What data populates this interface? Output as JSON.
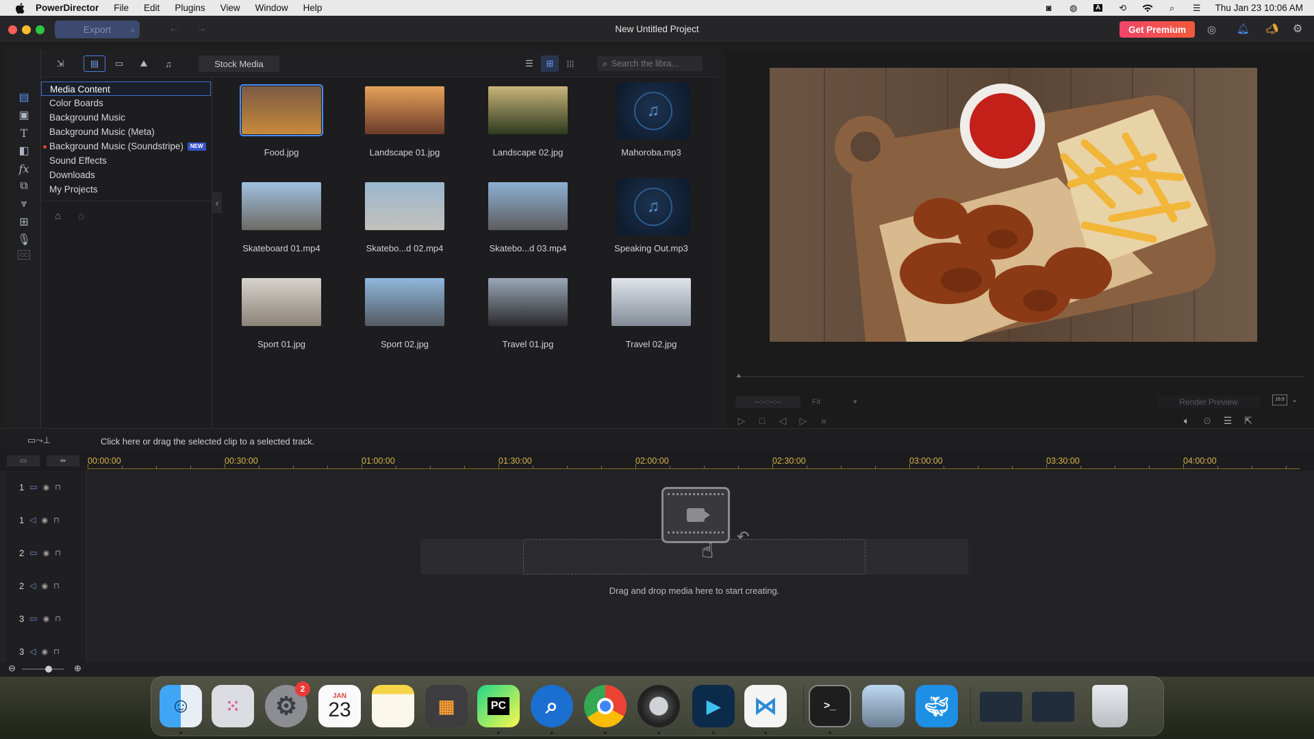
{
  "menubar": {
    "app_name": "PowerDirector",
    "items": [
      "File",
      "Edit",
      "Plugins",
      "View",
      "Window",
      "Help"
    ],
    "datetime": "Thu Jan 23  10:06 AM"
  },
  "window": {
    "title": "New Untitled Project",
    "export_label": "Export",
    "premium_label": "Get Premium"
  },
  "library": {
    "stock_media_label": "Stock Media",
    "search_placeholder": "Search the libra...",
    "categories": [
      {
        "label": "Media Content",
        "active": true
      },
      {
        "label": "Color Boards"
      },
      {
        "label": "Background Music"
      },
      {
        "label": "Background Music (Meta)"
      },
      {
        "label": "Background Music (Soundstripe)",
        "badge": "NEW"
      },
      {
        "label": "Sound Effects"
      },
      {
        "label": "Downloads"
      },
      {
        "label": "My Projects"
      }
    ],
    "media": [
      {
        "label": "Food.jpg",
        "kind": "image",
        "colors": [
          "#7a5a44",
          "#c98a3a"
        ]
      },
      {
        "label": "Landscape 01.jpg",
        "kind": "image",
        "colors": [
          "#e6a25a",
          "#6b3b2a"
        ]
      },
      {
        "label": "Landscape 02.jpg",
        "kind": "image",
        "colors": [
          "#c9b47a",
          "#2d3a1f"
        ]
      },
      {
        "label": "Mahoroba.mp3",
        "kind": "music"
      },
      {
        "label": "Skateboard 01.mp4",
        "kind": "image",
        "colors": [
          "#9fc1e0",
          "#6e6a64"
        ]
      },
      {
        "label": "Skatebo...d 02.mp4",
        "kind": "image",
        "colors": [
          "#9ab7cf",
          "#c3c0bb"
        ]
      },
      {
        "label": "Skatebo...d 03.mp4",
        "kind": "image",
        "colors": [
          "#8db0d2",
          "#5d5d5f"
        ]
      },
      {
        "label": "Speaking Out.mp3",
        "kind": "music"
      },
      {
        "label": "Sport 01.jpg",
        "kind": "image",
        "colors": [
          "#d7d3cd",
          "#8c8378"
        ]
      },
      {
        "label": "Sport 02.jpg",
        "kind": "image",
        "colors": [
          "#8fb7dc",
          "#545b63"
        ]
      },
      {
        "label": "Travel 01.jpg",
        "kind": "image",
        "colors": [
          "#9aa7b6",
          "#2b2b2d"
        ]
      },
      {
        "label": "Travel 02.jpg",
        "kind": "image",
        "colors": [
          "#dfe4ea",
          "#848d98"
        ]
      }
    ]
  },
  "preview": {
    "timecode": "--:--:--:--",
    "fit_label": "Fit",
    "render_label": "Render Preview",
    "aspect_label": "16:9"
  },
  "timeline": {
    "hint": "Click here or drag the selected clip to a selected track.",
    "ticks": [
      "00:00:00",
      "00:30:00",
      "01:00:00",
      "01:30:00",
      "02:00:00",
      "02:30:00",
      "03:00:00",
      "03:30:00",
      "04:00:00"
    ],
    "tracks": [
      {
        "num": "1",
        "type": "video"
      },
      {
        "num": "1",
        "type": "audio"
      },
      {
        "num": "2",
        "type": "video"
      },
      {
        "num": "2",
        "type": "audio"
      },
      {
        "num": "3",
        "type": "video"
      },
      {
        "num": "3",
        "type": "audio"
      }
    ],
    "drop_text": "Drag and drop media here to start creating."
  },
  "dock": {
    "calendar_month": "JAN",
    "calendar_day": "23",
    "settings_badge": "2",
    "pycharm_label": "PC"
  }
}
